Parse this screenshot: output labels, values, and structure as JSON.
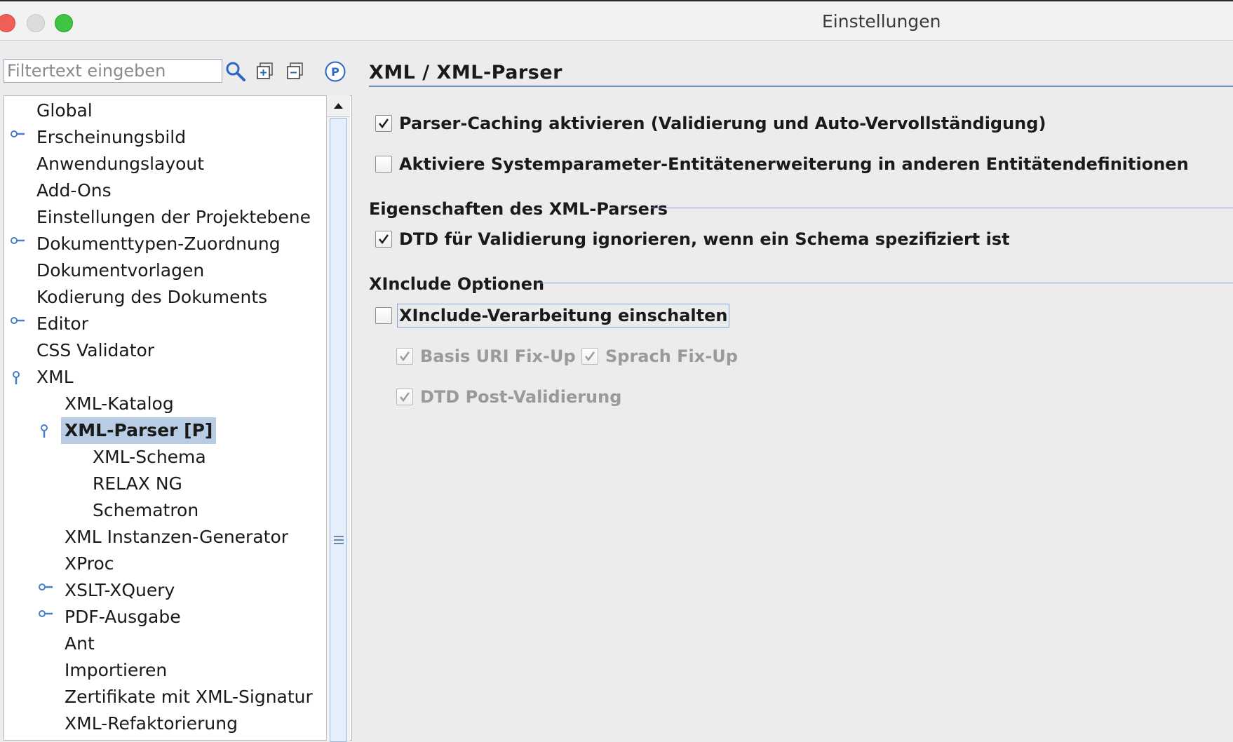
{
  "window": {
    "title": "Einstellungen"
  },
  "filter": {
    "placeholder": "Filtertext eingeben"
  },
  "tree": {
    "items": [
      {
        "label": "Global"
      },
      {
        "label": "Erscheinungsbild"
      },
      {
        "label": "Anwendungslayout"
      },
      {
        "label": "Add-Ons"
      },
      {
        "label": "Einstellungen der Projektebene"
      },
      {
        "label": "Dokumenttypen-Zuordnung"
      },
      {
        "label": "Dokumentvorlagen"
      },
      {
        "label": "Kodierung des Dokuments"
      },
      {
        "label": "Editor"
      },
      {
        "label": "CSS Validator"
      },
      {
        "label": "XML"
      },
      {
        "label": "XML-Katalog"
      },
      {
        "label": "XML-Parser [P]"
      },
      {
        "label": "XML-Schema"
      },
      {
        "label": "RELAX NG"
      },
      {
        "label": "Schematron"
      },
      {
        "label": "XML Instanzen-Generator"
      },
      {
        "label": "XProc"
      },
      {
        "label": "XSLT-XQuery"
      },
      {
        "label": "PDF-Ausgabe"
      },
      {
        "label": "Ant"
      },
      {
        "label": "Importieren"
      },
      {
        "label": "Zertifikate mit XML-Signatur"
      },
      {
        "label": "XML-Refaktorierung"
      }
    ]
  },
  "main": {
    "title": "XML / XML-Parser",
    "options": {
      "parser_caching": {
        "label": "Parser-Caching aktivieren (Validierung und Auto-Vervollständigung)",
        "checked": true
      },
      "system_param": {
        "label": "Aktiviere Systemparameter-Entitätenerweiterung in anderen Entitätendefinitionen",
        "checked": false
      }
    },
    "section_parser": {
      "heading": "Eigenschaften des XML-Parsers",
      "dtd_ignore": {
        "label": "DTD für Validierung ignorieren, wenn ein Schema spezifiziert ist",
        "checked": true
      }
    },
    "section_xinclude": {
      "heading": "XInclude Optionen",
      "enable": {
        "label": "XInclude-Verarbeitung einschalten",
        "checked": false
      },
      "base_uri": {
        "label": "Basis URI Fix-Up",
        "checked": true
      },
      "lang_fixup": {
        "label": "Sprach Fix-Up",
        "checked": true
      },
      "dtd_post": {
        "label": "DTD Post-Validierung",
        "checked": true
      }
    }
  },
  "colors": {
    "selection": "#b8cce4",
    "accent_line": "#6b8cc4",
    "disabled_text": "#9a9a9a"
  }
}
